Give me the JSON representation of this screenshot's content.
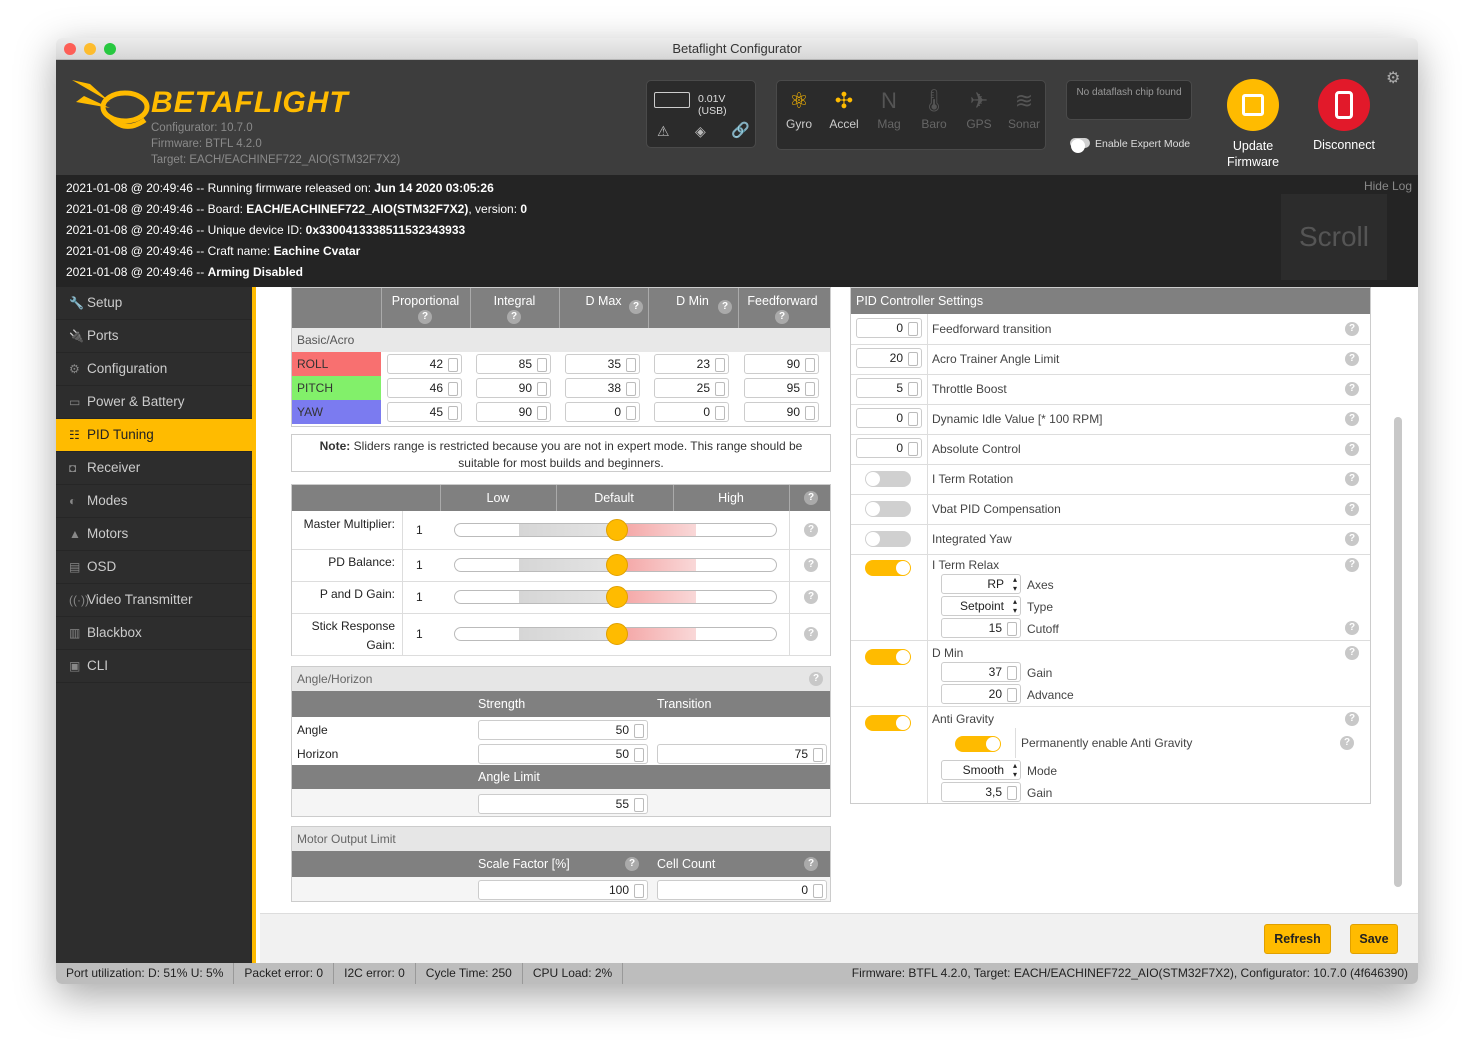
{
  "window": {
    "title": "Betaflight Configurator"
  },
  "header": {
    "brand": "BETAFLIGHT",
    "configurator": "Configurator: 10.7.0",
    "firmware": "Firmware: BTFL 4.2.0",
    "target": "Target: EACH/EACHINEF722_AIO(STM32F7X2)",
    "battery": "0.01V (USB)",
    "sensors": [
      {
        "label": "Gyro",
        "icon": "gyro-icon",
        "active": true
      },
      {
        "label": "Accel",
        "icon": "accel-icon",
        "active": true
      },
      {
        "label": "Mag",
        "icon": "mag-icon",
        "active": false
      },
      {
        "label": "Baro",
        "icon": "baro-icon",
        "active": false
      },
      {
        "label": "GPS",
        "icon": "gps-icon",
        "active": false
      },
      {
        "label": "Sonar",
        "icon": "sonar-icon",
        "active": false
      }
    ],
    "dataflash": "No dataflash chip found",
    "expert_mode": "Enable Expert Mode",
    "update_fw": "Update Firmware",
    "disconnect": "Disconnect",
    "accent": "#ffbb00",
    "disconnect_color": "#e2192a"
  },
  "log": {
    "hide": "Hide Log",
    "scroll": "Scroll",
    "lines": [
      {
        "pre": "2021-01-08 @ 20:49:46 -- Running firmware released on: ",
        "b": "Jun 14 2020 03:05:26",
        "post": ""
      },
      {
        "pre": "2021-01-08 @ 20:49:46 -- Board: ",
        "b": "EACH/EACHINEF722_AIO(STM32F7X2)",
        "post": ", version: ",
        "b2": "0"
      },
      {
        "pre": "2021-01-08 @ 20:49:46 -- Unique device ID: ",
        "b": "0x330041333851153234393​3",
        "post": ""
      },
      {
        "pre": "2021-01-08 @ 20:49:46 -- Craft name: ",
        "b": "Eachine Cvatar",
        "post": ""
      },
      {
        "pre": "2021-01-08 @ 20:49:46 -- ",
        "b": "Arming Disabled",
        "post": ""
      }
    ]
  },
  "nav": [
    {
      "label": "Setup",
      "icon": "wrench-icon"
    },
    {
      "label": "Ports",
      "icon": "plug-icon"
    },
    {
      "label": "Configuration",
      "icon": "gear-icon"
    },
    {
      "label": "Power & Battery",
      "icon": "battery-icon"
    },
    {
      "label": "PID Tuning",
      "icon": "sliders-icon",
      "active": true
    },
    {
      "label": "Receiver",
      "icon": "receiver-icon"
    },
    {
      "label": "Modes",
      "icon": "toggle-icon"
    },
    {
      "label": "Motors",
      "icon": "motor-icon"
    },
    {
      "label": "OSD",
      "icon": "osd-icon"
    },
    {
      "label": "Video Transmitter",
      "icon": "antenna-icon"
    },
    {
      "label": "Blackbox",
      "icon": "blackbox-icon"
    },
    {
      "label": "CLI",
      "icon": "terminal-icon"
    }
  ],
  "pid": {
    "headers": [
      "Proportional",
      "Integral",
      "D Max",
      "D Min",
      "Feedforward"
    ],
    "group": "Basic/Acro",
    "rows": [
      {
        "name": "ROLL",
        "color": "#f87070",
        "values": [
          "42",
          "85",
          "35",
          "23",
          "90"
        ]
      },
      {
        "name": "PITCH",
        "color": "#82f06a",
        "values": [
          "46",
          "90",
          "38",
          "25",
          "95"
        ]
      },
      {
        "name": "YAW",
        "color": "#7b7bf0",
        "values": [
          "45",
          "90",
          "0",
          "0",
          "90"
        ]
      }
    ]
  },
  "note": {
    "bold": "Note:",
    "text": " Sliders range is restricted because you are not in expert mode. This range should be suitable for most builds and beginners."
  },
  "sliders": {
    "headers": [
      "Low",
      "Default",
      "High"
    ],
    "rows": [
      {
        "label": "Master Multiplier:",
        "value": "1",
        "pos": 0.5
      },
      {
        "label": "PD Balance:",
        "value": "1",
        "pos": 0.5
      },
      {
        "label": "P and D Gain:",
        "value": "1",
        "pos": 0.5
      },
      {
        "label": "Stick Response Gain:",
        "value": "1",
        "pos": 0.5
      }
    ]
  },
  "angle": {
    "title": "Angle/Horizon",
    "strength": "Strength",
    "transition": "Transition",
    "angle_label": "Angle",
    "horizon_label": "Horizon",
    "angle_strength": "50",
    "horizon_strength": "50",
    "horizon_transition": "75",
    "limit_label": "Angle Limit",
    "limit": "55"
  },
  "motor": {
    "title": "Motor Output Limit",
    "scale_label": "Scale Factor [%]",
    "cell_label": "Cell Count",
    "scale": "100",
    "cells": "0"
  },
  "pidc": {
    "title": "PID Controller Settings",
    "rows": [
      {
        "value": "0",
        "label": "Feedforward transition"
      },
      {
        "value": "20",
        "label": "Acro Trainer Angle Limit"
      },
      {
        "value": "5",
        "label": "Throttle Boost"
      },
      {
        "value": "0",
        "label": "Dynamic Idle Value [* 100 RPM]"
      },
      {
        "value": "0",
        "label": "Absolute Control"
      }
    ],
    "toggles": [
      {
        "label": "I Term Rotation",
        "on": false
      },
      {
        "label": "Vbat PID Compensation",
        "on": false
      },
      {
        "label": "Integrated Yaw",
        "on": false
      }
    ],
    "iterm": {
      "label": "I Term Relax",
      "axes": "RP",
      "axes_label": "Axes",
      "type": "Setpoint",
      "type_label": "Type",
      "cutoff": "15",
      "cutoff_label": "Cutoff"
    },
    "dmin": {
      "label": "D Min",
      "gain": "37",
      "gain_label": "Gain",
      "advance": "20",
      "advance_label": "Advance"
    },
    "ag": {
      "label": "Anti Gravity",
      "perm": "Permanently enable Anti Gravity",
      "mode": "Smooth",
      "mode_label": "Mode",
      "gain": "3,5",
      "gain_label": "Gain"
    }
  },
  "buttons": {
    "refresh": "Refresh",
    "save": "Save"
  },
  "status": {
    "port": "Port utilization: D: 51% U: 5%",
    "packet": "Packet error: 0",
    "i2c": "I2C error: 0",
    "cycle": "Cycle Time: 250",
    "cpu": "CPU Load: 2%",
    "firmware": "Firmware: BTFL 4.2.0, Target: EACH/EACHINEF722_AIO(STM32F7X2), Configurator: 10.7.0 (4f646390)"
  }
}
